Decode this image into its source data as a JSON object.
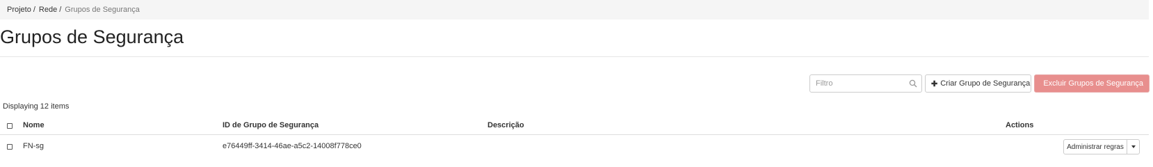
{
  "breadcrumb": {
    "items": [
      "Projeto",
      "Rede"
    ],
    "separator": "/",
    "current": "Grupos de Segurança"
  },
  "page": {
    "title": "Grupos de Segurança"
  },
  "toolbar": {
    "filter_placeholder": "Filtro",
    "create_label": "Criar Grupo de Segurança",
    "create_icon": "plus-icon",
    "delete_label": "Excluir Grupos de Segurança",
    "delete_icon": "trash-icon",
    "delete_color": "#e88f8e"
  },
  "table": {
    "count_text": "Displaying 12 items",
    "columns": {
      "name": "Nome",
      "id": "ID de Grupo de Segurança",
      "description": "Descrição",
      "actions": "Actions"
    },
    "rows": [
      {
        "name": "FN-sg",
        "id": "e76449ff-3414-46ae-a5c2-14008f778ce0",
        "description": "",
        "action_label": "Administrar regras"
      }
    ]
  }
}
